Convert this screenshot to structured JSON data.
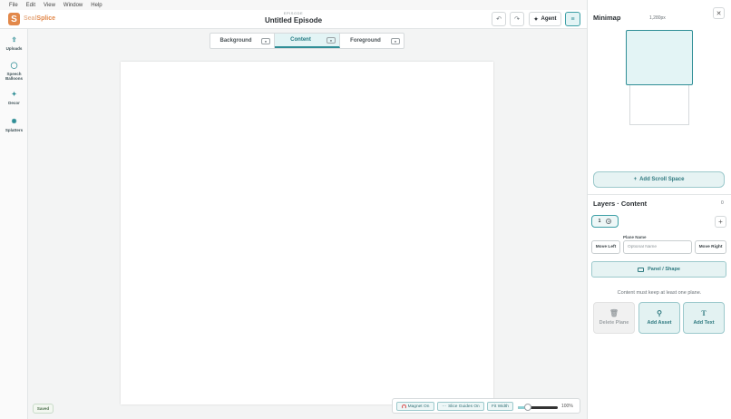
{
  "menu": [
    "File",
    "Edit",
    "View",
    "Window",
    "Help"
  ],
  "brand": {
    "logo_letter": "S",
    "name_prefix": "Seal",
    "name_suffix": "Splice"
  },
  "episode": {
    "kicker": "EPISODE",
    "title": "Untitled Episode"
  },
  "header": {
    "agent_label": "Agent",
    "agent_icon": "sparkle-icon"
  },
  "tools": [
    {
      "label": "Uploads",
      "icon": "upload-icon"
    },
    {
      "label": "Speech Balloons",
      "icon": "speech-balloon-icon"
    },
    {
      "label": "Decor",
      "icon": "sparkle-icon"
    },
    {
      "label": "Splatters",
      "icon": "splatter-icon"
    }
  ],
  "tabs": [
    {
      "label": "Background",
      "active": false
    },
    {
      "label": "Content",
      "active": true
    },
    {
      "label": "Foreground",
      "active": false
    }
  ],
  "status": {
    "saved": "Saved"
  },
  "bottombar": {
    "magnet": "Magnet On",
    "slice_guides": "Slice Guides On",
    "fit_width": "Fit Width",
    "zoom": "100%",
    "zoom_fraction": 0.25
  },
  "minimap": {
    "title": "Minimap",
    "size": "1,280px",
    "add_scroll_space": "Add Scroll Space"
  },
  "layers": {
    "title": "Layers · Content",
    "count": "0",
    "plane_number": "1",
    "plane_name_label": "Plane Name",
    "plane_name_placeholder": "Optional Name",
    "move_left": "Move Left",
    "move_right": "Move Right",
    "panel_shape": "Panel / Shape",
    "hint": "Content must keep at least one plane.",
    "delete_plane": "Delete Plane",
    "add_asset": "Add Asset",
    "add_text": "Add Text"
  },
  "colors": {
    "accent": "#2f8e96",
    "accent_light": "#e3f4f5",
    "brand": "#e2884a"
  }
}
